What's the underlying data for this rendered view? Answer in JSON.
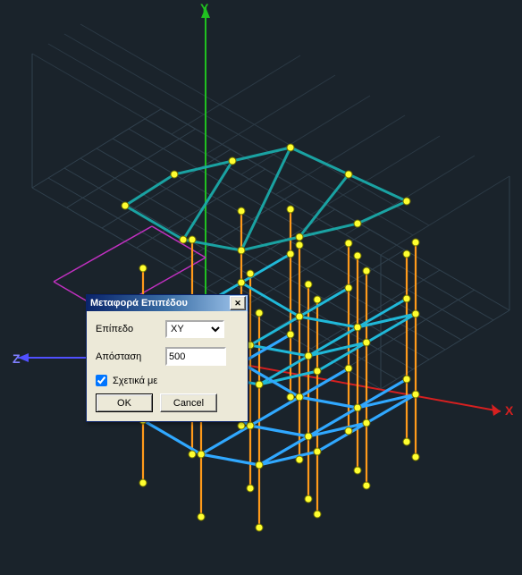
{
  "axes": {
    "x": "X",
    "y": "Y",
    "z": "Z"
  },
  "dialog": {
    "title": "Μεταφορά Επιπέδου",
    "level_label": "Επίπεδο",
    "level_value": "XY",
    "distance_label": "Απόσταση",
    "distance_value": "500",
    "relative_label": "Σχετικά με",
    "relative_checked": true,
    "ok": "OK",
    "cancel": "Cancel",
    "close_glyph": "✕"
  },
  "colors": {
    "grid": "#3b4a57",
    "x_axis": "#d62020",
    "y_axis": "#20c020",
    "z_axis": "#5050ff",
    "magenta": "#c030c0",
    "beam_top": "#1aa9a9",
    "beam_mid": "#20b8d8",
    "beam_bot": "#30a8ff",
    "column": "#ff9a1a",
    "node_fill": "#ffff30",
    "node_stroke": "#707000"
  }
}
